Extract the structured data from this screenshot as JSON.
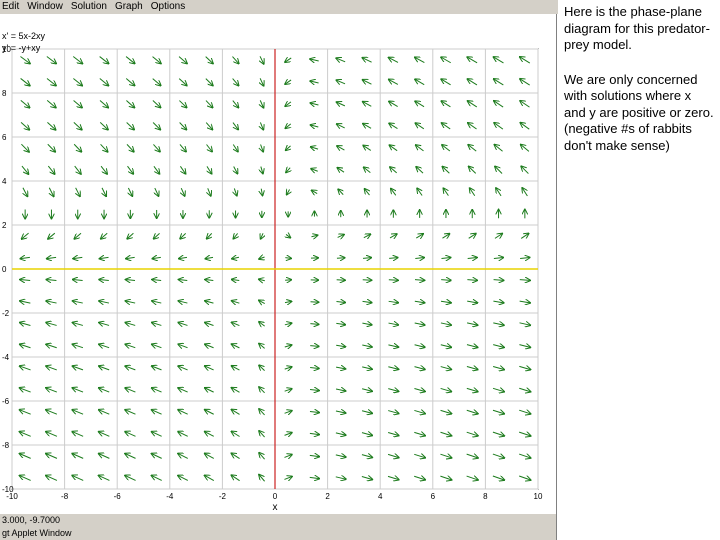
{
  "menu": [
    "Edit",
    "Window",
    "Solution",
    "Graph",
    "Options"
  ],
  "equations": [
    "x' = 5x-2xy",
    "y' = -y+xy"
  ],
  "status": {
    "coord_readout": "3.000, -9.7000",
    "applet_label": "gt Applet Window"
  },
  "side_text": {
    "paragraph1": "Here is the phase-plane diagram for this predator-prey model.",
    "paragraph2": "We are only concerned with solutions where x and y are positive or zero. (negative #s of rabbits don't make sense)"
  },
  "chart_data": {
    "type": "vector_field",
    "xlabel": "x",
    "ylabel": "",
    "xlim": [
      -10,
      10
    ],
    "ylim": [
      -10,
      10
    ],
    "x_ticks": [
      "-10",
      "-8",
      "-6",
      "-4",
      "-2",
      "0",
      "2",
      "4",
      "6",
      "8",
      "10"
    ],
    "y_ticks": [
      "10",
      "8",
      "6",
      "4",
      "2",
      "0",
      "-2",
      "-4",
      "-6",
      "-8",
      "-10"
    ],
    "field": {
      "dx": "5x-2xy",
      "dy": "-y+xy"
    },
    "grid": true,
    "colors": {
      "arrows": "#1a7a1a",
      "y_axis_line": "#cc2222",
      "x_axis_line": "#e8d400",
      "grid": "#cccccc"
    }
  }
}
